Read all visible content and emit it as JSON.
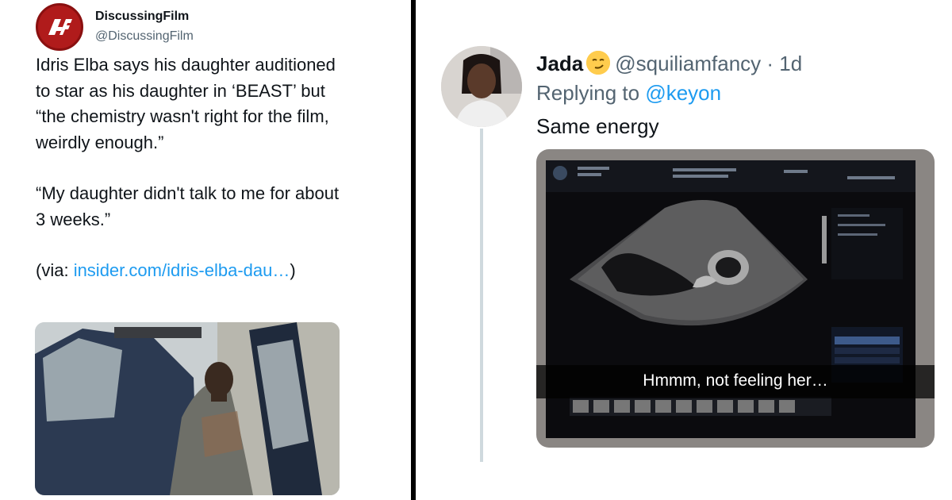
{
  "left_tweet": {
    "display_name": "DiscussingFilm",
    "handle": "@DiscussingFilm",
    "text_para1": "Idris Elba says his daughter auditioned to star as his daughter in ‘BEAST’ but “the chemistry wasn't right for the film, weirdly enough.”",
    "text_para2": "“My daughter didn't talk to me for about 3 weeks.”",
    "via_prefix": "(via: ",
    "via_link": "insider.com/idris-elba-dau…",
    "via_suffix": ")",
    "avatar_icon": "discussingfilm-logo-icon",
    "brand_color": "#b01b1b"
  },
  "right_tweet": {
    "display_name": "Jada",
    "emoji": "smirking-face-icon",
    "handle": "@squiliamfancy",
    "separator": " · ",
    "time": "1d",
    "replying_prefix": "Replying to ",
    "replying_to": "@keyon",
    "text": "Same energy",
    "image_caption": "Hmmm, not feeling her…",
    "link_color": "#1d9bf0"
  }
}
